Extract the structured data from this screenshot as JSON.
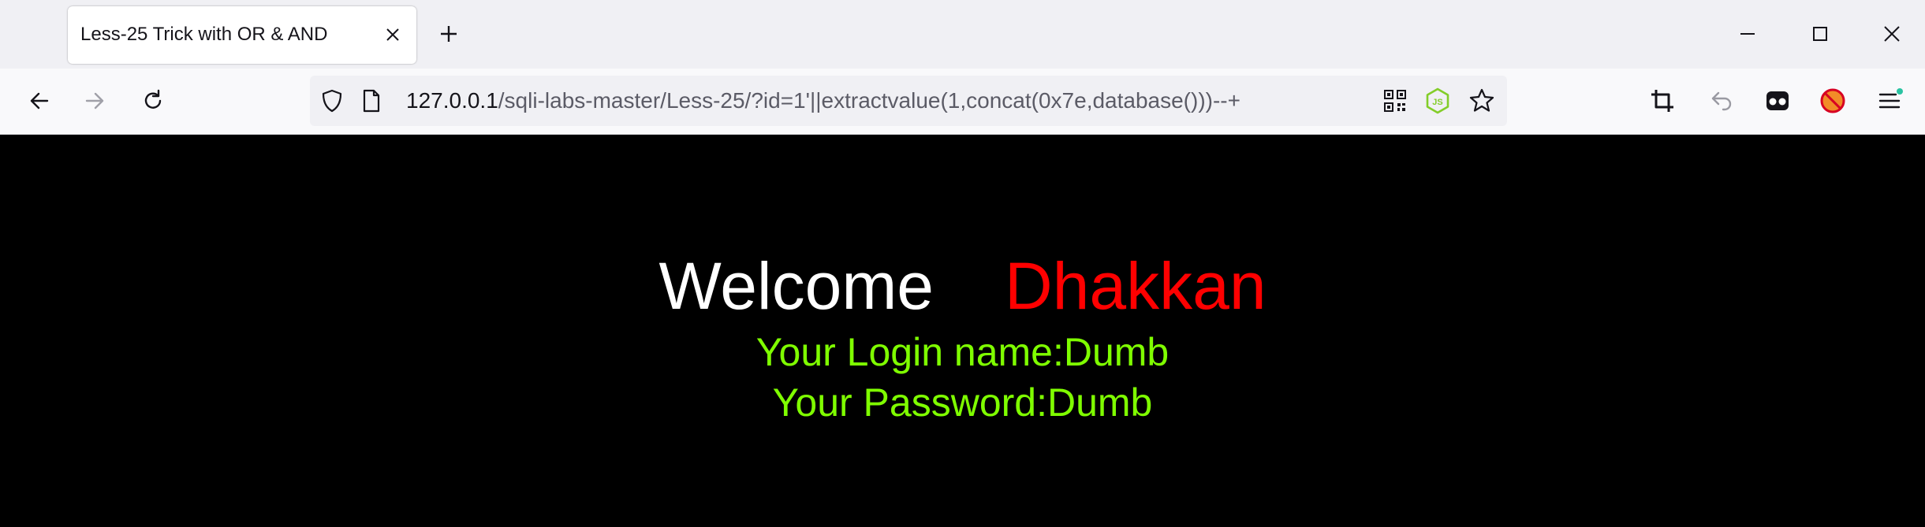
{
  "tab": {
    "title": "Less-25 Trick with OR & AND"
  },
  "toolbar": {
    "url_host": "127.0.0.1",
    "url_path": "/sqli-labs-master/Less-25/?id=1'||extractvalue(1,concat(0x7e,database()))--+"
  },
  "page": {
    "welcome": "Welcome",
    "name": "Dhakkan",
    "login_line": "Your Login name:Dumb",
    "password_line": "Your Password:Dumb"
  },
  "colors": {
    "background": "#000000",
    "welcome": "#ffffff",
    "name": "#ff0000",
    "info": "#7fff00"
  },
  "icons": [
    "back-icon",
    "forward-icon",
    "reload-icon",
    "shield-icon",
    "page-icon",
    "qr-code-icon",
    "nodejs-icon",
    "star-icon",
    "crop-icon",
    "undo-icon",
    "extension-icon",
    "blocked-icon",
    "menu-icon"
  ]
}
